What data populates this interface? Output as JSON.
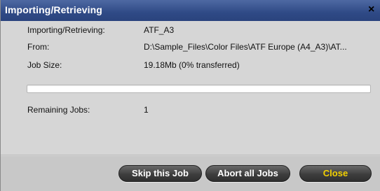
{
  "window": {
    "title": "Importing/Retrieving",
    "close_glyph": "×"
  },
  "details": {
    "importing_label": "Importing/Retrieving:",
    "importing_value": "ATF_A3",
    "from_label": "From:",
    "from_value": "D:\\Sample_Files\\Color Files\\ATF Europe (A4_A3)\\AT...",
    "job_size_label": "Job Size:",
    "job_size_value": "19.18Mb (0% transferred)",
    "remaining_label": "Remaining Jobs:",
    "remaining_value": "1"
  },
  "progress": {
    "percent": 0
  },
  "buttons": {
    "skip": "Skip this Job",
    "abort": "Abort all Jobs",
    "close": "Close"
  },
  "colors": {
    "title_bar": "#2f4a86",
    "button_dark": "#3e3e3e",
    "close_text": "#f2d000"
  }
}
